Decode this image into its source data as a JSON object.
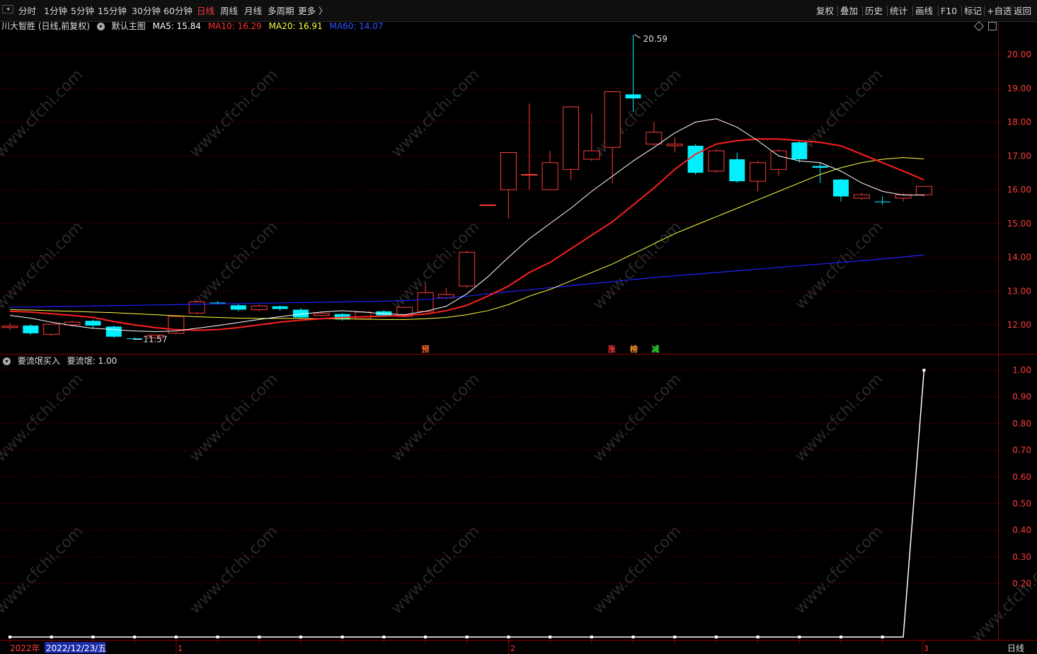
{
  "toolbar": {
    "left_items": [
      "分时",
      "1分钟",
      "5分钟",
      "15分钟",
      "30分钟",
      "60分钟",
      "日线",
      "周线",
      "月线",
      "多周期",
      "更多 〉"
    ],
    "active_item": "日线",
    "right_items": [
      "复权",
      "叠加",
      "历史",
      "统计",
      "画线",
      "F10",
      "标记",
      "+自选",
      "返回"
    ]
  },
  "main_header": {
    "stock": "川大智胜 (日线,前复权)",
    "template": "默认主图",
    "ma5": "MA5: 15.84",
    "ma10": "MA10: 16.29",
    "ma20": "MA20: 16.91",
    "ma60": "MA60: 14.07"
  },
  "sub_header": {
    "indicator": "要流氓买入",
    "value": "要流氓: 1.00"
  },
  "colors": {
    "up": "#ff3b3b",
    "down": "#00f0ff",
    "ma5": "#ffffff",
    "ma10": "#ff2020",
    "ma20": "#ffff40",
    "ma60": "#2020ff",
    "axis": "#8b0000",
    "grid": "#5a0000"
  },
  "main_axis": {
    "ticks": [
      20,
      19,
      18,
      17,
      16,
      15,
      14,
      13,
      12
    ],
    "labels": [
      "20.00",
      "19.00",
      "18.00",
      "17.00",
      "16.00",
      "15.00",
      "14.00",
      "13.00",
      "12.00"
    ]
  },
  "sub_axis": {
    "ticks": [
      1.0,
      0.9,
      0.8,
      0.7,
      0.6,
      0.5,
      0.4,
      0.3,
      0.2
    ],
    "labels": [
      "1.00",
      "0.90",
      "0.80",
      "0.70",
      "0.60",
      "0.50",
      "0.40",
      "0.30",
      "0.20"
    ]
  },
  "annotations": {
    "high": "20.59",
    "low": "11.57"
  },
  "markers": [
    {
      "text": "预",
      "color": "#ff6a2a"
    },
    {
      "text": "涨",
      "color": "#ff3b3b"
    },
    {
      "text": "榜",
      "color": "#ff9933"
    },
    {
      "text": "减",
      "color": "#33dd33"
    }
  ],
  "bottom_axis": {
    "year": "2022年",
    "date": "2022/12/23/五",
    "months": [
      "1",
      "2",
      "3"
    ]
  },
  "right_bottom_label": "日线",
  "watermark": "www.cfchi.com",
  "chart_data": {
    "type": "candlestick",
    "candles": [
      {
        "o": 11.92,
        "c": 11.96,
        "h": 12.05,
        "l": 11.85
      },
      {
        "o": 11.98,
        "c": 11.75,
        "h": 12.02,
        "l": 11.7
      },
      {
        "o": 11.72,
        "c": 12.02,
        "h": 12.04,
        "l": 11.66
      },
      {
        "o": 12.0,
        "c": 12.08,
        "h": 12.12,
        "l": 11.95
      },
      {
        "o": 12.12,
        "c": 11.98,
        "h": 12.16,
        "l": 11.9
      },
      {
        "o": 11.95,
        "c": 11.65,
        "h": 11.98,
        "l": 11.62
      },
      {
        "o": 11.6,
        "c": 11.59,
        "h": 11.63,
        "l": 11.57
      },
      {
        "o": 11.62,
        "c": 11.7,
        "h": 11.72,
        "l": 11.58
      },
      {
        "o": 11.75,
        "c": 12.25,
        "h": 12.28,
        "l": 11.72
      },
      {
        "o": 12.35,
        "c": 12.68,
        "h": 12.72,
        "l": 12.3
      },
      {
        "o": 12.66,
        "c": 12.64,
        "h": 12.7,
        "l": 12.6
      },
      {
        "o": 12.58,
        "c": 12.45,
        "h": 12.62,
        "l": 12.4
      },
      {
        "o": 12.45,
        "c": 12.56,
        "h": 12.6,
        "l": 12.4
      },
      {
        "o": 12.55,
        "c": 12.47,
        "h": 12.58,
        "l": 12.42
      },
      {
        "o": 12.45,
        "c": 12.22,
        "h": 12.5,
        "l": 12.18
      },
      {
        "o": 12.28,
        "c": 12.34,
        "h": 12.4,
        "l": 12.25
      },
      {
        "o": 12.32,
        "c": 12.16,
        "h": 12.35,
        "l": 12.12
      },
      {
        "o": 12.18,
        "c": 12.38,
        "h": 12.42,
        "l": 12.16
      },
      {
        "o": 12.4,
        "c": 12.28,
        "h": 12.44,
        "l": 12.25
      },
      {
        "o": 12.25,
        "c": 12.52,
        "h": 12.55,
        "l": 12.22
      },
      {
        "o": 12.4,
        "c": 12.95,
        "h": 13.25,
        "l": 12.38
      },
      {
        "o": 12.8,
        "c": 12.9,
        "h": 13.1,
        "l": 12.75
      },
      {
        "o": 13.15,
        "c": 14.15,
        "h": 14.2,
        "l": 13.1
      },
      {
        "o": 15.55,
        "c": 15.55,
        "h": 15.56,
        "l": 15.54
      },
      {
        "o": 16.0,
        "c": 17.1,
        "h": 17.12,
        "l": 15.15
      },
      {
        "o": 16.45,
        "c": 16.45,
        "h": 18.55,
        "l": 16.0
      },
      {
        "o": 16.0,
        "c": 16.8,
        "h": 17.15,
        "l": 16.0
      },
      {
        "o": 16.6,
        "c": 18.45,
        "h": 18.47,
        "l": 16.3
      },
      {
        "o": 16.9,
        "c": 17.15,
        "h": 18.25,
        "l": 16.85
      },
      {
        "o": 17.25,
        "c": 18.9,
        "h": 18.92,
        "l": 16.2
      },
      {
        "o": 18.82,
        "c": 18.7,
        "h": 20.59,
        "l": 18.3
      },
      {
        "o": 17.35,
        "c": 17.7,
        "h": 18.0,
        "l": 17.3
      },
      {
        "o": 17.3,
        "c": 17.35,
        "h": 17.55,
        "l": 17.1
      },
      {
        "o": 17.3,
        "c": 16.5,
        "h": 17.35,
        "l": 16.45
      },
      {
        "o": 16.55,
        "c": 17.15,
        "h": 17.2,
        "l": 16.5
      },
      {
        "o": 16.9,
        "c": 16.25,
        "h": 17.1,
        "l": 16.2
      },
      {
        "o": 16.25,
        "c": 16.8,
        "h": 16.85,
        "l": 15.95
      },
      {
        "o": 16.6,
        "c": 17.15,
        "h": 17.2,
        "l": 16.4
      },
      {
        "o": 17.4,
        "c": 16.9,
        "h": 17.45,
        "l": 16.8
      },
      {
        "o": 16.7,
        "c": 16.65,
        "h": 16.8,
        "l": 16.2
      },
      {
        "o": 16.3,
        "c": 15.8,
        "h": 16.32,
        "l": 15.65
      },
      {
        "o": 15.75,
        "c": 15.85,
        "h": 15.9,
        "l": 15.7
      },
      {
        "o": 15.65,
        "c": 15.64,
        "h": 15.8,
        "l": 15.55
      },
      {
        "o": 15.75,
        "c": 15.85,
        "h": 15.9,
        "l": 15.65
      },
      {
        "o": 15.85,
        "c": 16.1,
        "h": 16.12,
        "l": 15.8
      }
    ],
    "ma5": [
      12.28,
      12.2,
      12.08,
      11.98,
      11.9,
      11.86,
      11.82,
      11.8,
      11.82,
      11.9,
      11.98,
      12.07,
      12.16,
      12.24,
      12.32,
      12.38,
      12.42,
      12.38,
      12.33,
      12.3,
      12.4,
      12.55,
      12.92,
      13.42,
      14.0,
      14.55,
      15.0,
      15.45,
      15.95,
      16.4,
      16.85,
      17.25,
      17.68,
      18.0,
      18.1,
      17.85,
      17.45,
      17.0,
      16.85,
      16.8,
      16.55,
      16.2,
      15.95,
      15.84,
      15.84
    ],
    "ma10": [
      12.4,
      12.38,
      12.33,
      12.28,
      12.22,
      12.1,
      12.0,
      11.92,
      11.86,
      11.84,
      11.86,
      11.92,
      12.0,
      12.08,
      12.14,
      12.18,
      12.22,
      12.24,
      12.26,
      12.28,
      12.32,
      12.42,
      12.58,
      12.85,
      13.15,
      13.55,
      13.85,
      14.25,
      14.65,
      15.05,
      15.55,
      16.05,
      16.6,
      17.05,
      17.35,
      17.45,
      17.5,
      17.5,
      17.45,
      17.4,
      17.3,
      17.05,
      16.8,
      16.55,
      16.29
    ],
    "ma20": [
      12.45,
      12.44,
      12.42,
      12.4,
      12.38,
      12.36,
      12.33,
      12.3,
      12.27,
      12.24,
      12.22,
      12.2,
      12.19,
      12.19,
      12.19,
      12.18,
      12.18,
      12.17,
      12.16,
      12.16,
      12.18,
      12.22,
      12.3,
      12.42,
      12.6,
      12.85,
      13.05,
      13.3,
      13.55,
      13.8,
      14.1,
      14.4,
      14.7,
      14.95,
      15.2,
      15.45,
      15.7,
      15.95,
      16.2,
      16.45,
      16.65,
      16.8,
      16.9,
      16.95,
      16.91
    ],
    "ma60": [
      12.52,
      12.53,
      12.54,
      12.55,
      12.56,
      12.57,
      12.58,
      12.59,
      12.6,
      12.61,
      12.62,
      12.63,
      12.64,
      12.65,
      12.66,
      12.67,
      12.68,
      12.69,
      12.7,
      12.72,
      12.75,
      12.8,
      12.85,
      12.92,
      12.98,
      13.04,
      13.1,
      13.16,
      13.22,
      13.28,
      13.34,
      13.4,
      13.45,
      13.5,
      13.55,
      13.6,
      13.65,
      13.7,
      13.75,
      13.8,
      13.85,
      13.9,
      13.95,
      14.01,
      14.07
    ],
    "indicator": [
      0,
      0,
      0,
      0,
      0,
      0,
      0,
      0,
      0,
      0,
      0,
      0,
      0,
      0,
      0,
      0,
      0,
      0,
      0,
      0,
      0,
      0,
      0,
      0,
      0,
      0,
      0,
      0,
      0,
      0,
      0,
      0,
      0,
      0,
      0,
      0,
      0,
      0,
      0,
      0,
      0,
      0,
      0,
      0,
      1.0
    ]
  }
}
